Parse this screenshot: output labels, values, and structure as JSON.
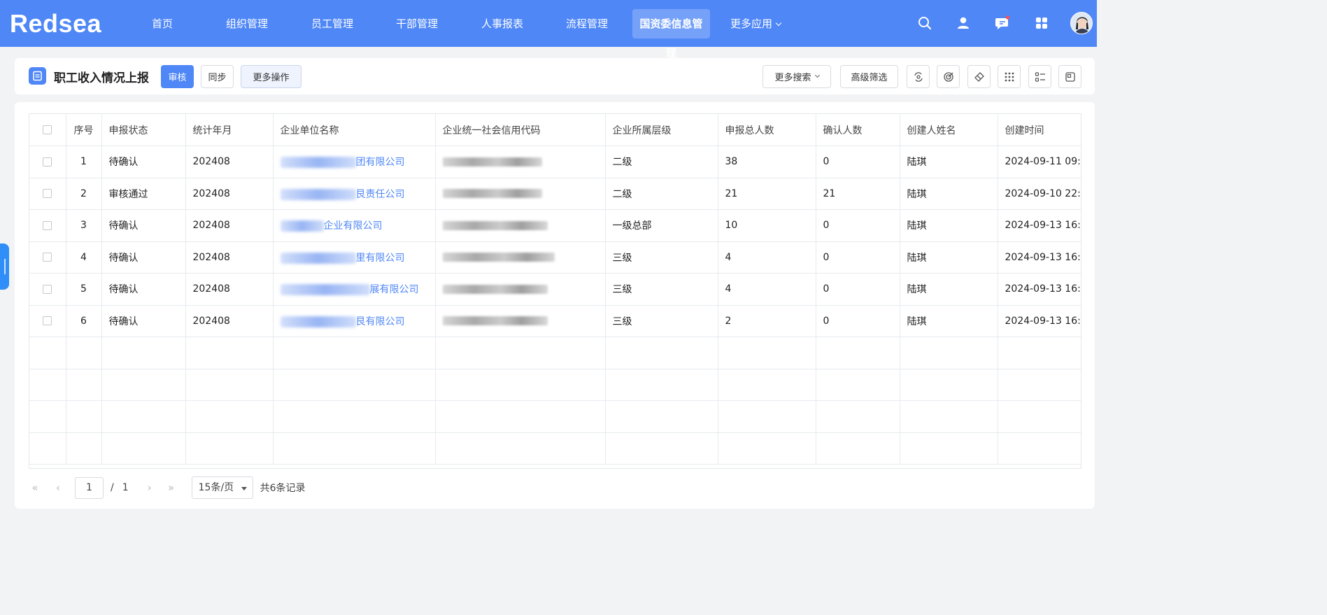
{
  "app": {
    "logo_text": "Redsea"
  },
  "nav": {
    "items": [
      {
        "label": "首页"
      },
      {
        "label": "组织管理"
      },
      {
        "label": "员工管理"
      },
      {
        "label": "干部管理"
      },
      {
        "label": "人事报表"
      },
      {
        "label": "流程管理"
      },
      {
        "label": "国资委信息管理",
        "active": true
      },
      {
        "label": "更多应用",
        "has_dropdown": true
      }
    ],
    "right_icons": [
      "search-icon",
      "user-icon",
      "message-icon",
      "apps-grid-icon"
    ],
    "notification_dot_color": "#ff4d4f"
  },
  "header": {
    "title": "职工收入情况上报",
    "buttons": {
      "review": "审核",
      "sync": "同步",
      "more_ops": "更多操作"
    },
    "more_search": "更多搜索",
    "advanced_filter": "高级筛选",
    "tool_icons": [
      "view-switch-icon",
      "target-icon",
      "clear-filter-icon",
      "grid-dots-icon",
      "list-settings-icon",
      "fullscreen-icon"
    ]
  },
  "table": {
    "columns": [
      "",
      "序号",
      "申报状态",
      "统计年月",
      "企业单位名称",
      "企业统一社会信用代码",
      "企业所属层级",
      "申报总人数",
      "确认人数",
      "创建人姓名",
      "创建时间"
    ],
    "rows": [
      {
        "no": "1",
        "status": "待确认",
        "month": "202408",
        "company_visible": "团有限公司",
        "level": "二级",
        "total": "38",
        "confirmed": "0",
        "creator": "陆琪",
        "created": "2024-09-11 09:"
      },
      {
        "no": "2",
        "status": "审核通过",
        "month": "202408",
        "company_visible": "艮责任公司",
        "level": "二级",
        "total": "21",
        "confirmed": "21",
        "creator": "陆琪",
        "created": "2024-09-10 22:"
      },
      {
        "no": "3",
        "status": "待确认",
        "month": "202408",
        "company_visible": "企业有限公司",
        "level": "一级总部",
        "total": "10",
        "confirmed": "0",
        "creator": "陆琪",
        "created": "2024-09-13 16:"
      },
      {
        "no": "4",
        "status": "待确认",
        "month": "202408",
        "company_visible": "里有限公司",
        "level": "三级",
        "total": "4",
        "confirmed": "0",
        "creator": "陆琪",
        "created": "2024-09-13 16:"
      },
      {
        "no": "5",
        "status": "待确认",
        "month": "202408",
        "company_visible": "展有限公司",
        "level": "三级",
        "total": "4",
        "confirmed": "0",
        "creator": "陆琪",
        "created": "2024-09-13 16:"
      },
      {
        "no": "6",
        "status": "待确认",
        "month": "202408",
        "company_visible": "艮有限公司",
        "level": "三级",
        "total": "2",
        "confirmed": "0",
        "creator": "陆琪",
        "created": "2024-09-13 16:"
      }
    ],
    "empty_rows": 4
  },
  "pagination": {
    "current_page": "1",
    "separator": "/",
    "total_pages": "1",
    "page_size": "15条/页",
    "total_label": "共6条记录"
  },
  "colors": {
    "primary": "#4f87f7",
    "link": "#4f87f7",
    "background": "#f2f3f5",
    "drawer_tab": "#2f8ef7"
  }
}
